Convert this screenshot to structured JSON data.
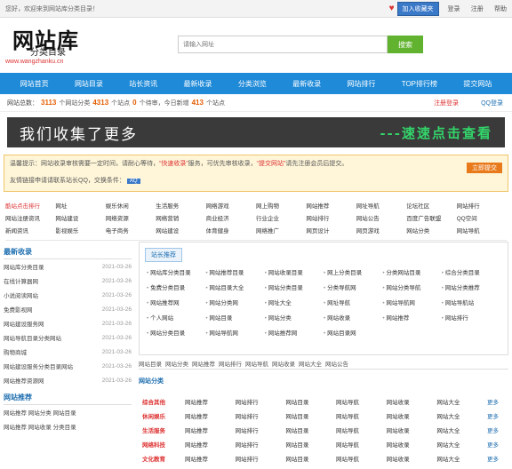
{
  "topbar": {
    "welcome": "您好，欢迎来到网站库分类目录！",
    "favorite": "加入收藏夹",
    "links": [
      "登录",
      "注册",
      "帮助"
    ]
  },
  "logo": {
    "title": "网站库",
    "subtitle": "分类目录",
    "url": "www.wangzhanku.cn"
  },
  "search": {
    "placeholder": "请输入网址",
    "button": "搜索"
  },
  "nav": [
    "网站首页",
    "网站目录",
    "站长资讯",
    "最新收录",
    "分类浏览",
    "最新收录",
    "网站排行",
    "TOP排行榜",
    "提交网站"
  ],
  "stats": {
    "prefix": "网站总数：",
    "items": [
      {
        "value": "3113",
        "text": "个网站分类"
      },
      {
        "value": "4313",
        "text": "个站点"
      },
      {
        "value": "0",
        "text": "个待审，今日新增"
      },
      {
        "value": "413",
        "text": "个站点"
      }
    ],
    "login": "注册登录",
    "qq": "QQ登录"
  },
  "banner": {
    "left": "我们收集了更多",
    "right": "---速速点击查看"
  },
  "notice": {
    "line1a": "温馨提示：网站收录审核需要一定时间，请耐心等待，",
    "highlight1": "“快速收录”",
    "line1b": "服务，可优先审核收录，",
    "highlight2": "“提交网站”",
    "line1c": "请先注册会员后提交。",
    "line2": "友情链接申请请联系站长QQ，交换条件：",
    "badge": "AQ",
    "right_button": "立即提交"
  },
  "linkgrid": [
    [
      "酷站点击排行",
      "网址",
      "娱乐休闲",
      "生活服务",
      "网络游戏",
      "网上购物",
      "网站推荐",
      "网址导航",
      "论坛社区",
      "网站排行"
    ],
    [
      "网站注册资讯",
      "网站建设",
      "网络资源",
      "网络营销",
      "商业经济",
      "行业企业",
      "网站排行",
      "网站公告",
      "百度广告联盟",
      "QQ空间"
    ],
    [
      "新闻资讯",
      "影视娱乐",
      "电子商务",
      "网站建设",
      "体育健身",
      "网络推广",
      "网页设计",
      "网页游戏",
      "网站分类",
      "网站导航"
    ]
  ],
  "left": {
    "title1": "最新收录",
    "items": [
      {
        "name": "网站库分类目录",
        "date": "2021-03-26"
      },
      {
        "name": "在线计算器网",
        "date": "2021-03-26"
      },
      {
        "name": "小说阅读网站",
        "date": "2021-03-26"
      },
      {
        "name": "免费影视网",
        "date": "2021-03-26"
      },
      {
        "name": "网站建设服务网",
        "date": "2021-03-26"
      },
      {
        "name": "网站导航目录分类网站",
        "date": "2021-03-26"
      },
      {
        "name": "购物商城",
        "date": "2021-03-26"
      },
      {
        "name": "网站建设服务分类目录网站",
        "date": "2021-03-26"
      },
      {
        "name": "网站推荐资源网",
        "date": "2021-03-26"
      }
    ],
    "title2": "网站推荐",
    "items2": [
      "网站推荐 网站分类 网站目录",
      "网站推荐 网站收录 分类目录"
    ]
  },
  "panel": {
    "tab": "站长推荐",
    "items": [
      "网站库分类目录",
      "网站推荐目录",
      "网站收录目录",
      "网上分类目录",
      "分类网站目录",
      "综合分类目录",
      "免费分类目录",
      "网站目录大全",
      "网站分类目录",
      "分类导航网",
      "网站分类导航",
      "网站分类推荐",
      "网站推荐网",
      "网站分类网",
      "网址大全",
      "网址导航",
      "网站导航网",
      "网站导航站",
      "个人网站",
      "网站目录",
      "网站分类",
      "网站收录",
      "网站推荐",
      "网站排行",
      "网站分类目录",
      "网站导航网",
      "网站推荐网",
      "网站目录网"
    ]
  },
  "catbar": [
    "网站目录",
    "网站分类",
    "网站推荐",
    "网站排行",
    "网站导航",
    "网站收录",
    "网站大全",
    "网站公告"
  ],
  "cathead": "网站分类",
  "sites": [
    {
      "label": "综合其他",
      "items": [
        "网站推荐",
        "网站排行",
        "网站目录",
        "网站导航",
        "网站收录",
        "网站大全"
      ],
      "more": "更多"
    },
    {
      "label": "休闲娱乐",
      "items": [
        "网站推荐",
        "网站排行",
        "网站目录",
        "网站导航",
        "网站收录",
        "网站大全"
      ],
      "more": "更多"
    },
    {
      "label": "生活服务",
      "items": [
        "网站推荐",
        "网站排行",
        "网站目录",
        "网站导航",
        "网站收录",
        "网站大全"
      ],
      "more": "更多"
    },
    {
      "label": "网络科技",
      "items": [
        "网站推荐",
        "网站排行",
        "网站目录",
        "网站导航",
        "网站收录",
        "网站大全"
      ],
      "more": "更多"
    },
    {
      "label": "文化教育",
      "items": [
        "网站推荐",
        "网站排行",
        "网站目录",
        "网站导航",
        "网站收录",
        "网站大全"
      ],
      "more": "更多"
    }
  ]
}
